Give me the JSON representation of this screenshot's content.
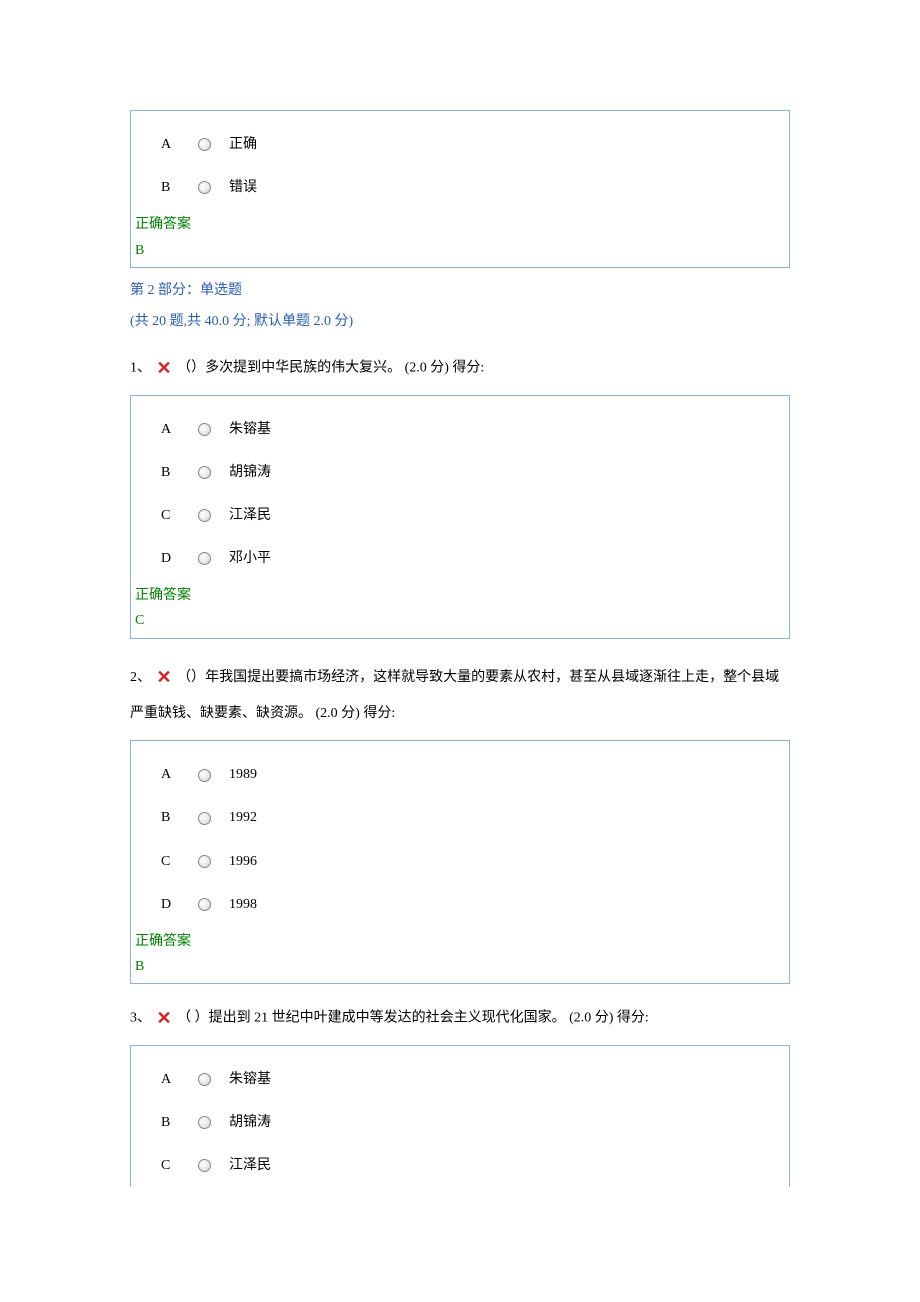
{
  "correct_answer_label": "正确答案",
  "top_block": {
    "options": [
      {
        "letter": "A",
        "text": "正确"
      },
      {
        "letter": "B",
        "text": "错误"
      }
    ],
    "correct": "B"
  },
  "section": {
    "title": "第 2 部分：单选题",
    "info": "(共 20 题,共 40.0 分; 默认单题 2.0 分)"
  },
  "questions": [
    {
      "num": "1、",
      "wrong": true,
      "text_before": "（）多次提到中华民族的伟大复兴。",
      "points": "(2.0 分)",
      "score_label": " 得分:",
      "options": [
        {
          "letter": "A",
          "text": "朱镕基"
        },
        {
          "letter": "B",
          "text": "胡锦涛"
        },
        {
          "letter": "C",
          "text": "江泽民"
        },
        {
          "letter": "D",
          "text": "邓小平"
        }
      ],
      "correct": "C"
    },
    {
      "num": "2、",
      "wrong": true,
      "text_before": "（）年我国提出要搞市场经济，这样就导致大量的要素从农村，甚至从县域逐渐往上走，整个县域严重缺钱、缺要素、缺资源。",
      "points": "(2.0 分)",
      "score_label": " 得分:",
      "options": [
        {
          "letter": "A",
          "text": "1989"
        },
        {
          "letter": "B",
          "text": "1992"
        },
        {
          "letter": "C",
          "text": "1996"
        },
        {
          "letter": "D",
          "text": "1998"
        }
      ],
      "correct": "B"
    },
    {
      "num": "3、",
      "wrong": true,
      "text_before": "（ ）提出到 21 世纪中叶建成中等发达的社会主义现代化国家。",
      "points": "(2.0 分)",
      "score_label": " 得分:",
      "options": [
        {
          "letter": "A",
          "text": "朱镕基"
        },
        {
          "letter": "B",
          "text": "胡锦涛"
        },
        {
          "letter": "C",
          "text": "江泽民"
        }
      ],
      "correct": null
    }
  ]
}
